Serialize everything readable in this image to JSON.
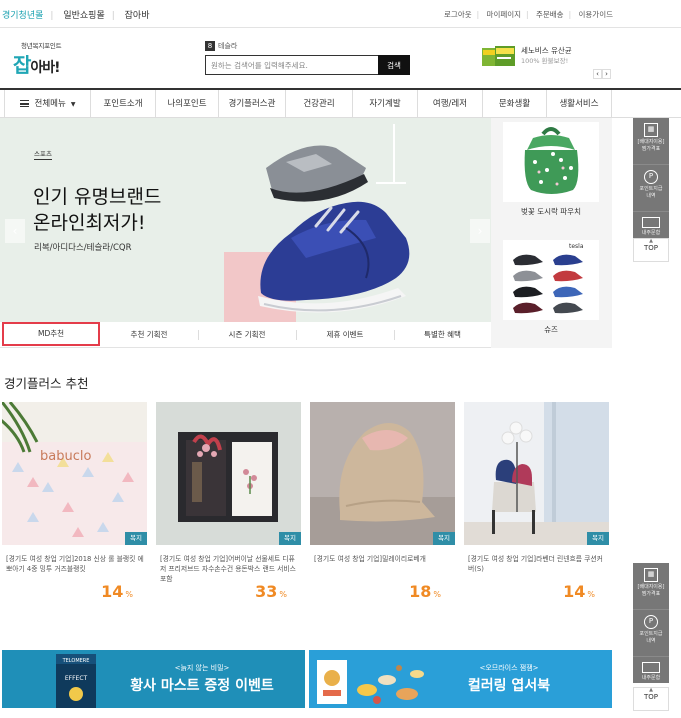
{
  "topbar": {
    "sites": [
      "경기청년몰",
      "일반쇼핑몰",
      "잡아바"
    ],
    "links": [
      "로그아웃",
      "마이페이지",
      "주문배송",
      "이용가이드"
    ]
  },
  "header": {
    "logo_sub": "청년복지포인트",
    "logo_main": "잡",
    "logo_rest": "아바!",
    "search": {
      "hot_num": "8",
      "hot_word": "테슬라",
      "placeholder": "원하는 검색어를 입력해주세요.",
      "button": "검색"
    },
    "promo": {
      "title": "세노비스 유산균",
      "subtitle": "100% 환불보장!"
    }
  },
  "gnb": {
    "all_menu": "전체메뉴",
    "items": [
      "포인트소개",
      "나의포인트",
      "경기플러스관",
      "건강관리",
      "자기계발",
      "여행/레저",
      "문화생활",
      "생활서비스"
    ]
  },
  "hero": {
    "category": "스포츠",
    "title_line1": "인기 유명브랜드",
    "title_line2": "온라인최저가!",
    "desc": "리복/아디다스/테슬라/CQR",
    "tabs": [
      "MD추천",
      "추천 기획전",
      "시즌 기획전",
      "제휴 이벤트",
      "특별한 혜택"
    ],
    "side": [
      {
        "label": "벚꽃 도시락 파우치"
      },
      {
        "label": "슈즈",
        "img_text": "tesla"
      }
    ]
  },
  "quick": {
    "items": [
      "[배대지이용]\n찜가격표",
      "포인트지급\n내역",
      "내주문함"
    ],
    "top": "TOP"
  },
  "recommend": {
    "title": "경기플러스 추천",
    "products": [
      {
        "badge": "복지",
        "name": "[경기도 여성 창업 기업]2018 신상 롤 블랭킷 에뽀아기 4중 밍투 거즈블랭킷",
        "pct": "14",
        "img_text": "babuclo"
      },
      {
        "badge": "복지",
        "name": "[경기도 여성 창업 기업]어버이날 선물세트 디퓨저 프리저브드 자수손수건 용돈박스 랜드 서비스 포함",
        "pct": "33"
      },
      {
        "badge": "복지",
        "name": "[경기도 여성 창업 기업]밀레이리로베개",
        "pct": "18"
      },
      {
        "badge": "복지",
        "name": "[경기도 여성 창업 기업]라벤더 린넨흐름 쿠션커버(S)",
        "pct": "14"
      }
    ],
    "pct_unit": "%"
  },
  "banners": [
    {
      "sub": "<늙지 않는 비밀>",
      "main": "황사 마스트 증정 이벤트",
      "book_line1": "TELOMERE",
      "book_line2": "EFFECT",
      "color": "#1f8fb8"
    },
    {
      "sub": "<오므라이스 잼잼>",
      "main": "컬러링 엽서북",
      "color": "#2a9fd8"
    }
  ],
  "colors": {
    "brand": "#1fa6b5",
    "active_tab": "#e43c4a",
    "discount": "#f08a24",
    "badge": "#2f8ea7"
  }
}
